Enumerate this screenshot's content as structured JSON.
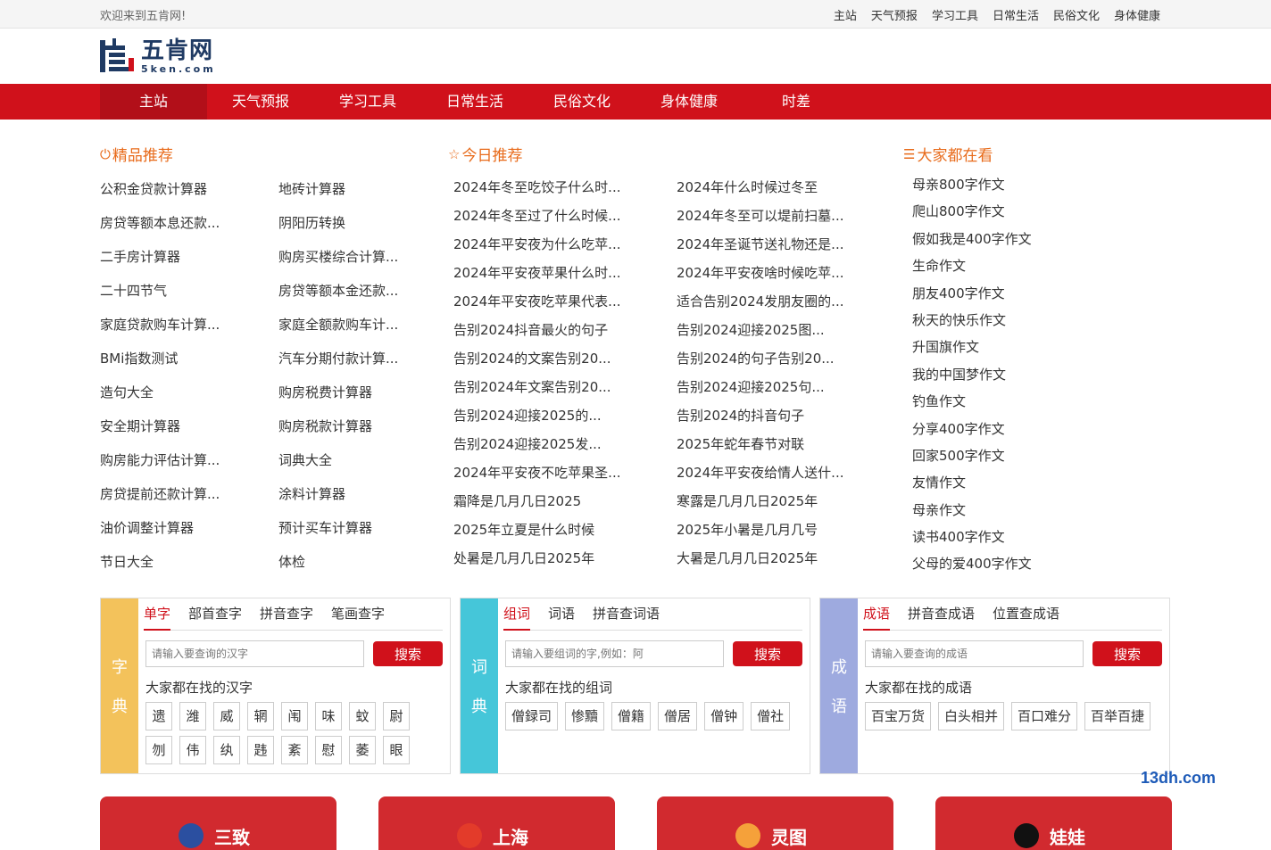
{
  "topbar": {
    "welcome": "欢迎来到五肯网!",
    "links": [
      "主站",
      "天气预报",
      "学习工具",
      "日常生活",
      "民俗文化",
      "身体健康"
    ]
  },
  "logo": {
    "cn": "五肯网",
    "en": "5ken.com",
    "brand_color": "#1f3a63"
  },
  "nav": {
    "items": [
      "主站",
      "天气预报",
      "学习工具",
      "日常生活",
      "民俗文化",
      "身体健康",
      "时差"
    ],
    "active_index": 0,
    "color": "#d0111b"
  },
  "sections": {
    "jingpin": {
      "icon": "power-icon",
      "title": "精品推荐"
    },
    "jinri": {
      "icon": "star-icon",
      "title": "今日推荐"
    },
    "dajia": {
      "icon": "search-list-icon",
      "title": "大家都在看"
    }
  },
  "jingpin_items": [
    "公积金贷款计算器",
    "地砖计算器",
    "房贷等额本息还款...",
    "阴阳历转换",
    "二手房计算器",
    "购房买楼综合计算...",
    "二十四节气",
    "房贷等额本金还款...",
    "家庭贷款购车计算...",
    "家庭全额款购车计...",
    "BMi指数测试",
    "汽车分期付款计算...",
    "造句大全",
    "购房税费计算器",
    "安全期计算器",
    "购房税款计算器",
    "购房能力评估计算...",
    "词典大全",
    "房贷提前还款计算...",
    "涂料计算器",
    "油价调整计算器",
    "预计买车计算器",
    "节日大全",
    "体检"
  ],
  "jinri_items": [
    "2024年冬至吃饺子什么时...",
    "2024年什么时候过冬至",
    "2024年冬至过了什么时候...",
    "2024年冬至可以堤前扫墓...",
    "2024年平安夜为什么吃苹...",
    "2024年圣诞节送礼物还是...",
    "2024年平安夜苹果什么时...",
    "2024年平安夜啥时候吃苹...",
    "2024年平安夜吃苹果代表...",
    "适合告别2024发朋友圈的...",
    "告别2024抖音最火的句子",
    "告别2024迎接2025图...",
    "告别2024的文案告别20...",
    "告别2024的句子告别20...",
    "告别2024年文案告别20...",
    "告别2024迎接2025句...",
    "告别2024迎接2025的...",
    "告别2024的抖音句子",
    "告别2024迎接2025发...",
    "2025年蛇年春节对联",
    "2024年平安夜不吃苹果圣...",
    "2024年平安夜给情人送什...",
    "霜降是几月几日2025",
    "寒露是几月几日2025年",
    "2025年立夏是什么时候",
    "2025年小暑是几月几号",
    "处暑是几月几日2025年",
    "大暑是几月几日2025年"
  ],
  "dajia_items": [
    "母亲800字作文",
    "爬山800字作文",
    "假如我是400字作文",
    "生命作文",
    "朋友400字作文",
    "秋天的快乐作文",
    "升国旗作文",
    "我的中国梦作文",
    "钓鱼作文",
    "分享400字作文",
    "回家500字作文",
    "友情作文",
    "母亲作文",
    "读书400字作文",
    "父母的爱400字作文"
  ],
  "dicts": [
    {
      "side": [
        "字",
        "典"
      ],
      "color": "#f3c25b",
      "tabs": [
        "单字",
        "部首查字",
        "拼音查字",
        "笔画查字"
      ],
      "placeholder": "请输入要查询的汉字",
      "button": "搜索",
      "hot_label": "大家都在找的汉字",
      "chips": [
        "遗",
        "潍",
        "威",
        "辋",
        "闱",
        "味",
        "蚊",
        "尉",
        "刎",
        "伟",
        "纨",
        "韪",
        "紊",
        "慰",
        "萎",
        "眼"
      ]
    },
    {
      "side": [
        "词",
        "典"
      ],
      "color": "#45c6d9",
      "tabs": [
        "组词",
        "词语",
        "拼音查词语"
      ],
      "placeholder": "请输入要组词的字,例如：阿",
      "button": "搜索",
      "hot_label": "大家都在找的组词",
      "chips": [
        "僧録司",
        "惨黷",
        "僧籍",
        "僧居",
        "僧钟",
        "僧社"
      ]
    },
    {
      "side": [
        "成",
        "语"
      ],
      "color": "#9eaadf",
      "tabs": [
        "成语",
        "拼音查成语",
        "位置查成语"
      ],
      "placeholder": "请输入要查询的成语",
      "button": "搜索",
      "hot_label": "大家都在找的成语",
      "chips": [
        "百宝万货",
        "白头相并",
        "百口难分",
        "百举百捷"
      ]
    }
  ],
  "watermark": "13dh.com",
  "cards": [
    {
      "text": "三致",
      "flag_color": "#2b4fa0"
    },
    {
      "text": "上海",
      "flag_color": "#e33b2a"
    },
    {
      "text": "灵图",
      "flag_color": "#f5a13a"
    },
    {
      "text": "娃娃",
      "flag_color": "#111111"
    }
  ]
}
